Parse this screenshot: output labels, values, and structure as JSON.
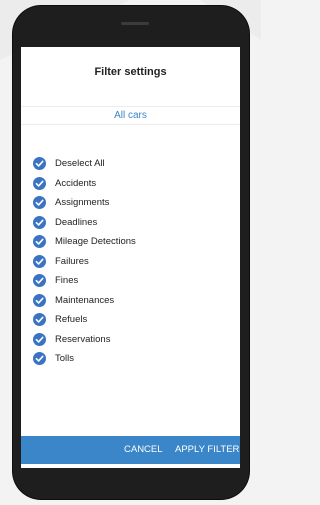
{
  "screen": {
    "title": "Filter settings",
    "car_selector": "All cars"
  },
  "filters": [
    {
      "label": "Deselect All",
      "checked": true
    },
    {
      "label": "Accidents",
      "checked": true
    },
    {
      "label": "Assignments",
      "checked": true
    },
    {
      "label": "Deadlines",
      "checked": true
    },
    {
      "label": "Mileage Detections",
      "checked": true
    },
    {
      "label": "Failures",
      "checked": true
    },
    {
      "label": "Fines",
      "checked": true
    },
    {
      "label": "Maintenances",
      "checked": true
    },
    {
      "label": "Refuels",
      "checked": true
    },
    {
      "label": "Reservations",
      "checked": true
    },
    {
      "label": "Tolls",
      "checked": true
    }
  ],
  "actions": {
    "cancel": "CANCEL",
    "apply": "APPLY FILTER"
  },
  "colors": {
    "accent": "#3a86c8",
    "check": "#3a73c4",
    "phone": "#1e1e1e"
  },
  "icons": {
    "check": "checkmark-circle-icon"
  }
}
